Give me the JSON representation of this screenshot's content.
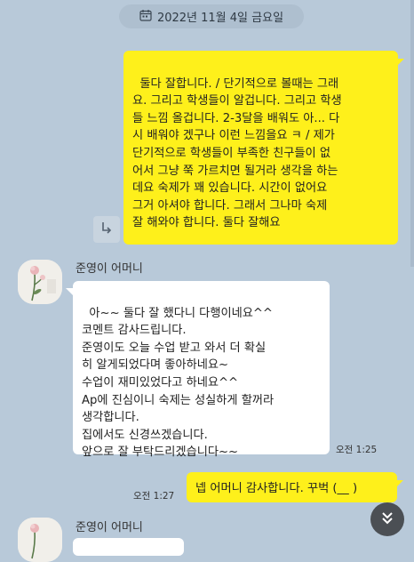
{
  "date_divider": {
    "label": "2022년 11월 4일 금요일",
    "icon": "calendar-icon"
  },
  "messages": {
    "mine1": {
      "text": "둘다 잘합니다. / 단기적으로 볼때는 그래\n요. 그리고 학생들이 알겁니다. 그리고 학생\n들 느낌 올겁니다. 2-3달을 배워도 아... 다\n시 배워야 겠구나 이런 느낌을요 ㅋ / 제가\n단기적으로 학생들이 부족한 친구들이 없\n어서 그냥 쭉 가르치면 될거라 생각을 하는\n데요 숙제가 꽤 있습니다. 시간이 없어요\n그거 아셔야 합니다. 그래서 그나마 숙제\n잘 해와야 합니다. 둘다 잘해요",
      "reply_icon": "reply-arrow-icon"
    },
    "other1": {
      "sender": "준영이 어머니",
      "text": "아~~ 둘다 잘 했다니 다행이네요^^\n코멘트 감사드립니다.\n준영이도 오늘 수업 받고 와서 더 확실\n히 알게되었다며 좋아하네요~\n수업이 재미있었다고 하네요^^\nAp에 진심이니 숙제는 성실하게 할꺼라\n생각합니다.\n집에서도 신경쓰겠습니다.\n앞으로 잘 부탁드리겠습니다~~",
      "time": "오전 1:25"
    },
    "mine2": {
      "text": "넵 어머니 감사합니다. 꾸벅 (__ )",
      "time": "오전 1:27"
    },
    "other2": {
      "sender": "준영이 어머니"
    }
  },
  "controls": {
    "scroll_down_icon": "chevron-double-down-icon"
  },
  "colors": {
    "background": "#b8c9d9",
    "my_bubble": "#fef01b",
    "other_bubble": "#ffffff"
  }
}
